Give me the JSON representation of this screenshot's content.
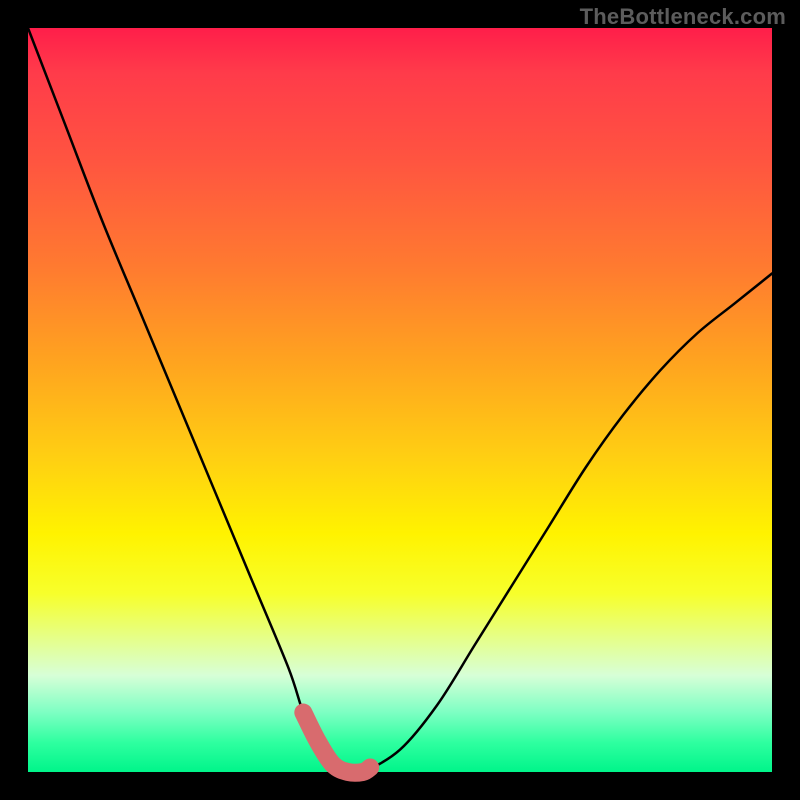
{
  "watermark": "TheBottleneck.com",
  "colors": {
    "frame": "#000000",
    "gradient_top": "#ff1e4a",
    "gradient_bottom": "#00f58a",
    "curve": "#000000",
    "highlight": "#d86b6e"
  },
  "chart_data": {
    "type": "line",
    "title": "",
    "xlabel": "",
    "ylabel": "",
    "xlim": [
      0,
      100
    ],
    "ylim": [
      0,
      100
    ],
    "x": [
      0,
      5,
      10,
      15,
      20,
      25,
      30,
      35,
      37,
      39,
      41,
      43,
      45,
      50,
      55,
      60,
      65,
      70,
      75,
      80,
      85,
      90,
      95,
      100
    ],
    "values": [
      100,
      87,
      74,
      62,
      50,
      38,
      26,
      14,
      8,
      4,
      1,
      0,
      0,
      3,
      9,
      17,
      25,
      33,
      41,
      48,
      54,
      59,
      63,
      67
    ],
    "highlight_x_range": [
      37,
      46
    ],
    "annotations": []
  }
}
